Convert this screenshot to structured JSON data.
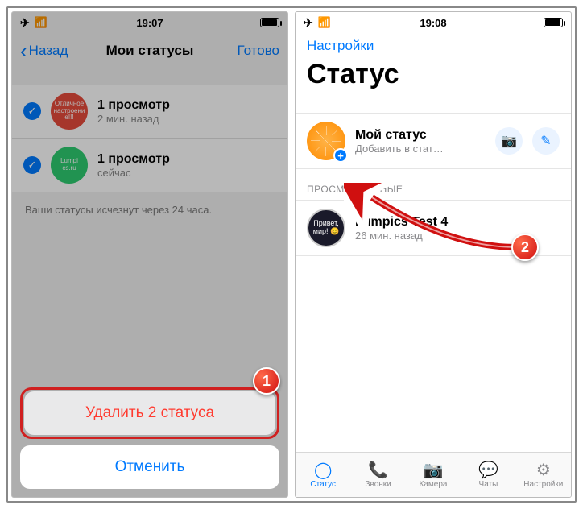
{
  "left": {
    "statusbar": {
      "time": "19:07"
    },
    "nav": {
      "back": "Назад",
      "title": "Мои статусы",
      "done": "Готово"
    },
    "rows": [
      {
        "avatar_text": "Отличное\nнастроени\nе!!!",
        "title": "1 просмотр",
        "subtitle": "2 мин. назад"
      },
      {
        "avatar_text": "Lumpi\ncs.ru",
        "title": "1 просмотр",
        "subtitle": "сейчас"
      }
    ],
    "footer": "Ваши статусы исчезнут через 24 часа.",
    "sheet": {
      "delete": "Удалить 2 статуса",
      "cancel": "Отменить"
    },
    "callout": "1"
  },
  "right": {
    "statusbar": {
      "time": "19:08"
    },
    "nav_back": "Настройки",
    "title": "Статус",
    "mystatus": {
      "title": "Мой статус",
      "subtitle": "Добавить в стат…"
    },
    "section": "ПРОСМОТРЕННЫЕ",
    "viewed": {
      "avatar_text": "Привет,\nмир! 😊",
      "title": "Lumpics Test 4",
      "subtitle": "26 мин. назад"
    },
    "tabs": {
      "status": "Статус",
      "calls": "Звонки",
      "camera": "Камера",
      "chats": "Чаты",
      "settings": "Настройки"
    },
    "callout": "2"
  }
}
